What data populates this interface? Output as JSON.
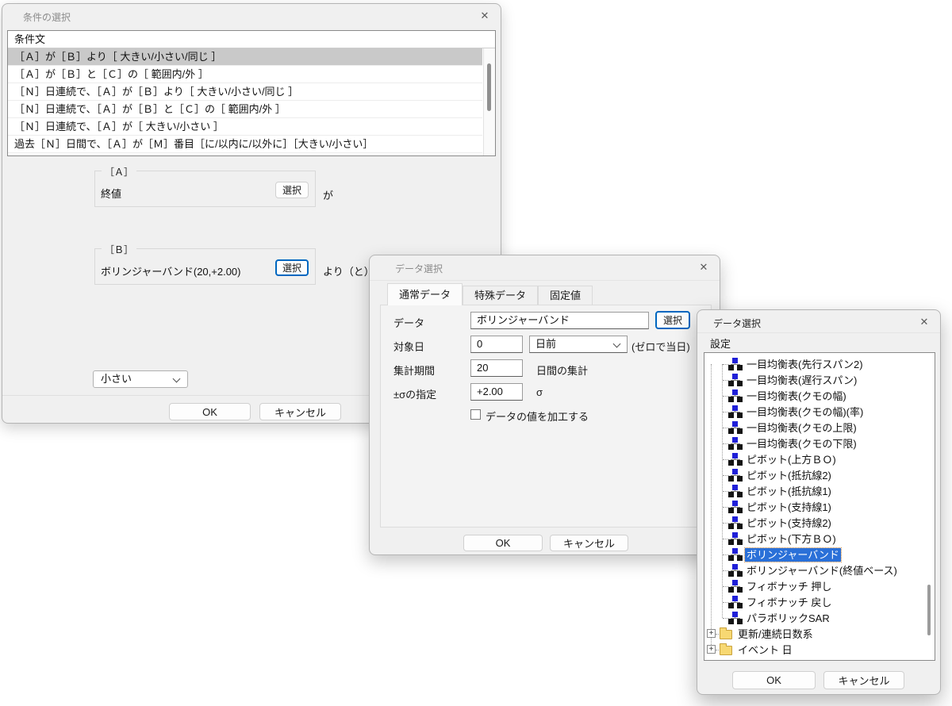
{
  "colors": {
    "dialog_bg": "#f0f0f0",
    "selection_blue": "#2a70d8",
    "inactive_selection_gray": "#c9c9c9",
    "focus_button_border": "#0067c0",
    "tree_icon_blue": "#1f1fd8",
    "folder_yellow": "#f7d872",
    "focus_rect_dotted": "#cc8a3d"
  },
  "condition_dialog": {
    "title": "条件の選択",
    "close_glyph": "✕",
    "list": {
      "header": "条件文",
      "rows": [
        {
          "text": "［Ａ］が［Ｂ］より［ 大きい/小さい/同じ ］",
          "selected": true
        },
        {
          "text": "［Ａ］が［Ｂ］と［Ｃ］の［ 範囲内/外 ］",
          "selected": false
        },
        {
          "text": "［Ｎ］日連続で、［Ａ］が［Ｂ］より［ 大きい/小さい/同じ ］",
          "selected": false
        },
        {
          "text": "［Ｎ］日連続で、［Ａ］が［Ｂ］と［Ｃ］の［ 範囲内/外 ］",
          "selected": false
        },
        {
          "text": "［Ｎ］日連続で、［Ａ］が［ 大きい/小さい ］",
          "selected": false
        },
        {
          "text": "過去［Ｎ］日間で、［Ａ］が［Ｍ］番目［に/以内に/以外に］［大きい/小さい］",
          "selected": false
        }
      ]
    },
    "group_a": {
      "label": "［Ａ］",
      "value": "終値",
      "select_label": "選択",
      "suffix": "が"
    },
    "group_b": {
      "label": "［Ｂ］",
      "value": "ボリンジャーバンド(20,+2.00)",
      "select_label": "選択",
      "suffix": "より（と）"
    },
    "comparison_dropdown": {
      "value": "小さい"
    },
    "ok_label": "OK",
    "cancel_label": "キャンセル"
  },
  "data_dialog": {
    "title": "データ選択",
    "close_glyph": "✕",
    "tabs": [
      {
        "label": "通常データ",
        "selected": true
      },
      {
        "label": "特殊データ",
        "selected": false
      },
      {
        "label": "固定値",
        "selected": false
      }
    ],
    "fields": {
      "data": {
        "label": "データ",
        "value": "ボリンジャーバンド",
        "select_label": "選択"
      },
      "target_day": {
        "label": "対象日",
        "value": "0",
        "unit_value": "日前",
        "note": "(ゼロで当日)"
      },
      "period": {
        "label": "集計期間",
        "value": "20",
        "suffix": "日間の集計"
      },
      "sigma": {
        "label": "±σの指定",
        "value": "+2.00",
        "suffix": "σ"
      },
      "process_checkbox": {
        "label": "データの値を加工する",
        "checked": false
      }
    },
    "ok_label": "OK",
    "cancel_label": "キャンセル"
  },
  "tree_dialog": {
    "title": "データ選択",
    "close_glyph": "✕",
    "menu_label": "設定",
    "items": [
      {
        "type": "leaf",
        "text": "一目均衡表(先行スパン2)",
        "selected": false
      },
      {
        "type": "leaf",
        "text": "一目均衡表(遅行スパン)",
        "selected": false
      },
      {
        "type": "leaf",
        "text": "一目均衡表(クモの幅)",
        "selected": false
      },
      {
        "type": "leaf",
        "text": "一目均衡表(クモの幅)(率)",
        "selected": false
      },
      {
        "type": "leaf",
        "text": "一目均衡表(クモの上限)",
        "selected": false
      },
      {
        "type": "leaf",
        "text": "一目均衡表(クモの下限)",
        "selected": false
      },
      {
        "type": "leaf",
        "text": "ピボット(上方ＢＯ)",
        "selected": false
      },
      {
        "type": "leaf",
        "text": "ピボット(抵抗線2)",
        "selected": false
      },
      {
        "type": "leaf",
        "text": "ピボット(抵抗線1)",
        "selected": false
      },
      {
        "type": "leaf",
        "text": "ピボット(支持線1)",
        "selected": false
      },
      {
        "type": "leaf",
        "text": "ピボット(支持線2)",
        "selected": false
      },
      {
        "type": "leaf",
        "text": "ピボット(下方ＢＯ)",
        "selected": false
      },
      {
        "type": "leaf",
        "text": "ボリンジャーバンド",
        "selected": true
      },
      {
        "type": "leaf",
        "text": "ボリンジャーバンド(終値ベース)",
        "selected": false
      },
      {
        "type": "leaf",
        "text": "フィボナッチ 押し",
        "selected": false
      },
      {
        "type": "leaf",
        "text": "フィボナッチ 戻し",
        "selected": false
      },
      {
        "type": "leaf",
        "text": "パラボリックSAR",
        "selected": false
      },
      {
        "type": "folder",
        "text": "更新/連続日数系",
        "selected": false
      },
      {
        "type": "folder",
        "text": "イベント 日",
        "selected": false
      }
    ],
    "ok_label": "OK",
    "cancel_label": "キャンセル"
  }
}
